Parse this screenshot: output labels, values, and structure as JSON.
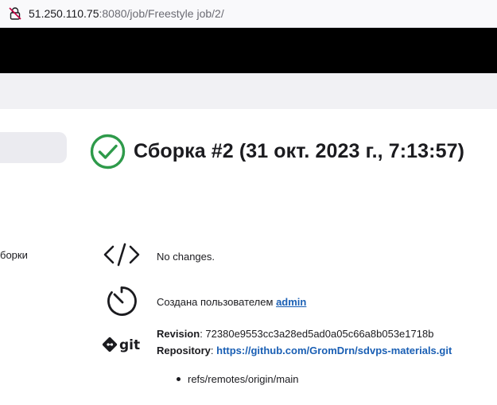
{
  "browser": {
    "url_host": "51.250.110.75",
    "url_rest": ":8080/job/Freestyle job/2/"
  },
  "sidebar": {
    "partial_item": "борки"
  },
  "build": {
    "title": "Сборка #2 (31 окт. 2023 г., 7:13:57)",
    "status_icon": "success-check-icon",
    "status_color": "#2e9a4a"
  },
  "details": {
    "changes_text": "No changes.",
    "created_by_prefix": "Создана пользователем",
    "created_by_user": "admin",
    "revision_label": "Revision",
    "revision_value": "72380e9553cc3a28ed5ad0a05c66a8b053e1718b",
    "repository_label": "Repository",
    "repository_url": "https://github.com/GromDrn/sdvps-materials.git",
    "branches": [
      "refs/remotes/origin/main"
    ]
  },
  "colors": {
    "header_bg": "#000000",
    "breadcrumb_bg": "#f1f1f4",
    "link": "#1a5fb4"
  }
}
